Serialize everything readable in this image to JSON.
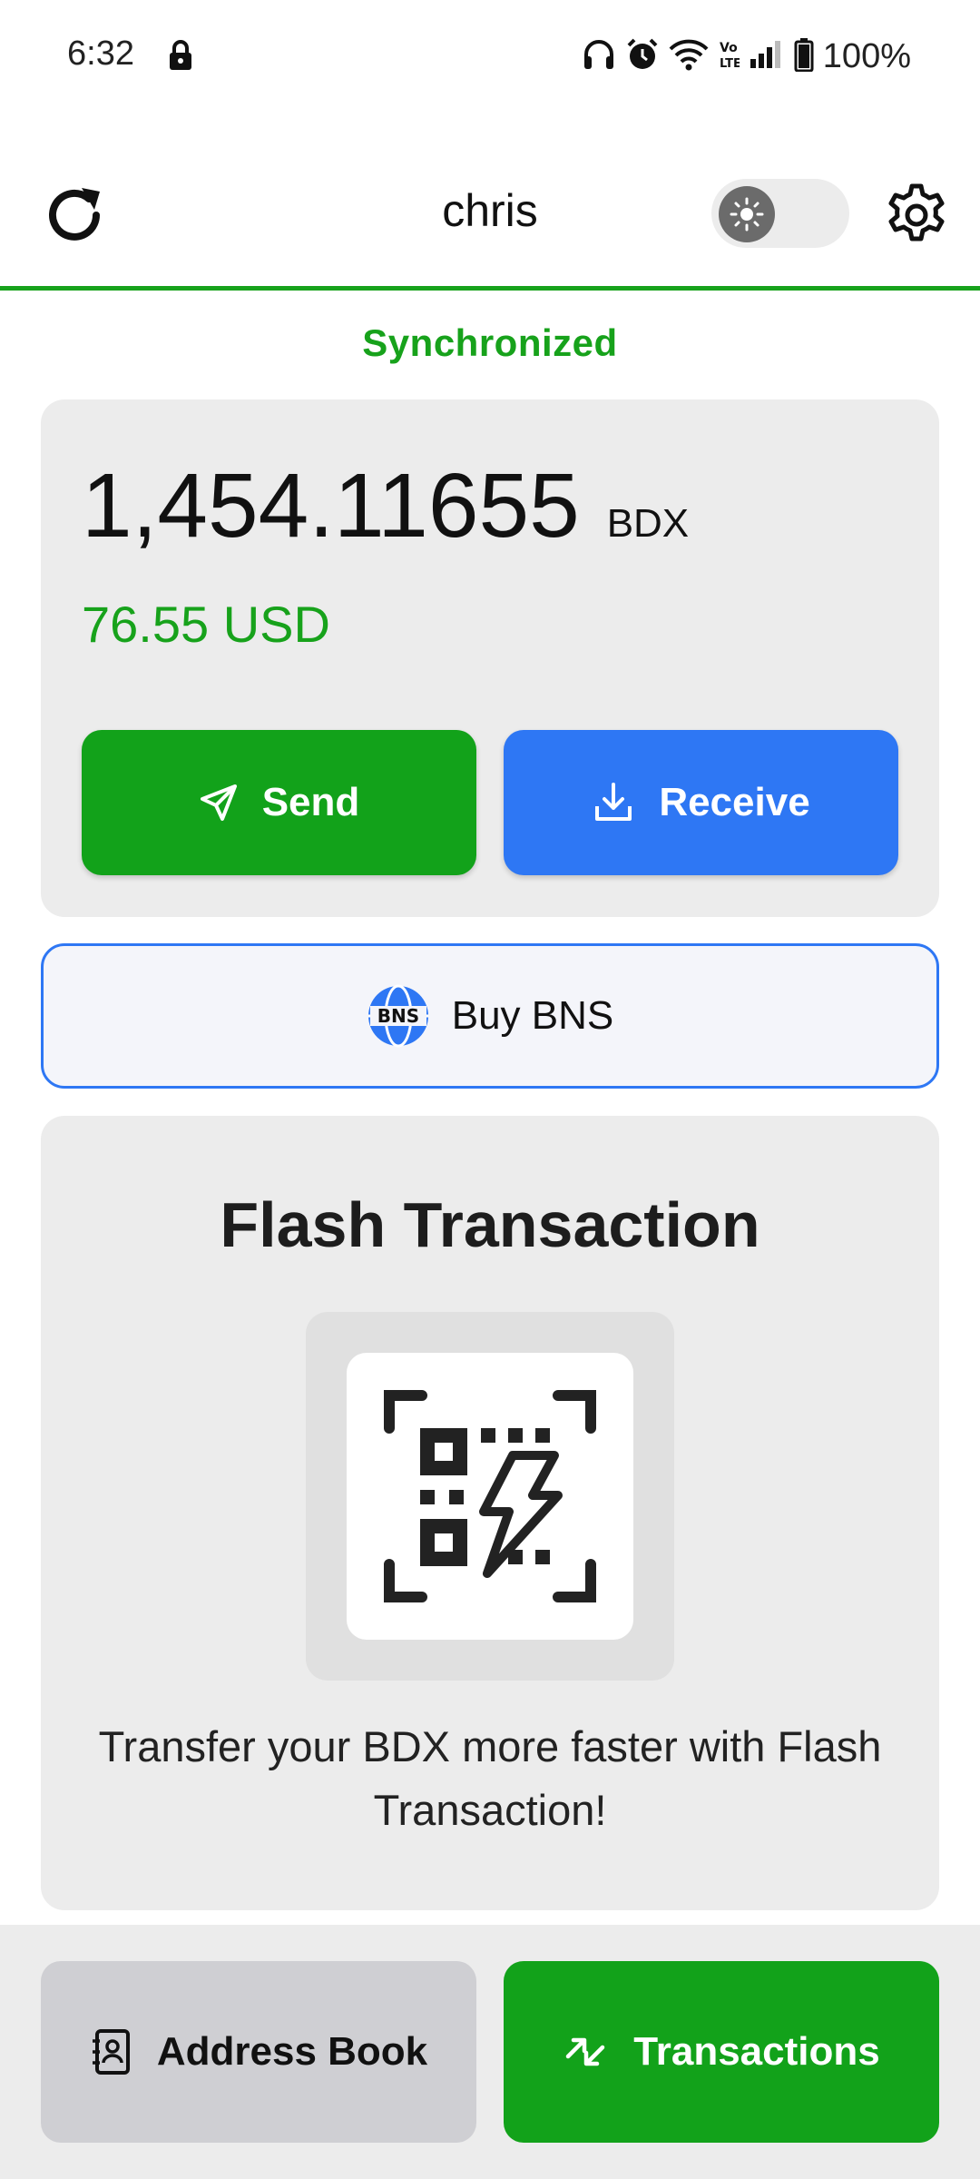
{
  "status_bar": {
    "time": "6:32",
    "battery": "100%",
    "icons": [
      "lock-icon",
      "headphones-icon",
      "alarm-icon",
      "wifi-icon",
      "volte-icon",
      "signal-icon",
      "battery-icon"
    ]
  },
  "header": {
    "wallet_name": "chris",
    "theme_toggle_state": "light"
  },
  "sync_status": "Synchronized",
  "balance": {
    "amount": "1,454.11655",
    "unit": "BDX",
    "fiat": "76.55 USD"
  },
  "actions": {
    "send_label": "Send",
    "receive_label": "Receive"
  },
  "buy_bns": {
    "label": "Buy BNS",
    "logo_text": "BNS"
  },
  "flash": {
    "title": "Flash Transaction",
    "description": "Transfer your BDX more faster with Flash Transaction!"
  },
  "bottom_nav": {
    "address_book_label": "Address Book",
    "transactions_label": "Transactions"
  },
  "colors": {
    "accent_green": "#12a21a",
    "accent_blue": "#2e77f4",
    "card_bg": "#ececec"
  }
}
